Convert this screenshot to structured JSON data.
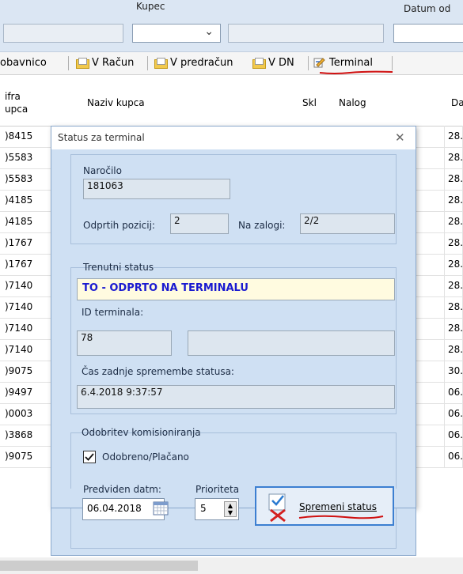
{
  "filter": {
    "kupec_label": "Kupec",
    "datum_od_label": "Datum od",
    "chevron": "⌄"
  },
  "toolbar": {
    "items": [
      {
        "label": "obavnico",
        "icon": ""
      },
      {
        "label": "V Račun",
        "icon": "folder-icon"
      },
      {
        "label": "V predračun",
        "icon": "folder-icon"
      },
      {
        "label": "V DN",
        "icon": "folder-icon"
      },
      {
        "label": "Terminal",
        "icon": "terminal-icon"
      }
    ]
  },
  "grid": {
    "headers": {
      "sifra_line1": "ifra",
      "sifra_line2": "upca",
      "naziv": "Naziv kupca",
      "skl": "Skl",
      "nalog": "Nalog",
      "da": "Da"
    },
    "rows": [
      {
        "sifra": ")8415",
        "datum": "28."
      },
      {
        "sifra": ")5583",
        "datum": "28."
      },
      {
        "sifra": ")5583",
        "datum": "28."
      },
      {
        "sifra": ")4185",
        "datum": "28."
      },
      {
        "sifra": ")4185",
        "datum": "28."
      },
      {
        "sifra": ")1767",
        "datum": "28."
      },
      {
        "sifra": ")1767",
        "datum": "28."
      },
      {
        "sifra": ")7140",
        "datum": "28."
      },
      {
        "sifra": ")7140",
        "datum": "28."
      },
      {
        "sifra": ")7140",
        "datum": "28."
      },
      {
        "sifra": ")7140",
        "datum": "28."
      },
      {
        "sifra": ")9075",
        "datum": "30."
      },
      {
        "sifra": ")9497",
        "datum": "06."
      },
      {
        "sifra": ")0003",
        "datum": "06."
      },
      {
        "sifra": ")3868",
        "datum": "06."
      },
      {
        "sifra": ")9075",
        "datum": "06."
      }
    ]
  },
  "dialog": {
    "title": "Status za terminal",
    "close": "✕",
    "narocilo_label": "Naročilo",
    "narocilo_value": "181063",
    "odprtih_label": "Odprtih pozicij:",
    "odprtih_value": "2",
    "zaloga_label": "Na zalogi:",
    "zaloga_value": "2/2",
    "trenutni_label": "Trenutni status",
    "status_value": "TO - ODPRTO NA TERMINALU",
    "terminal_label": "ID terminala:",
    "terminal_value": "78",
    "terminal_value2": "",
    "cas_label": "Čas zadnje spremembe statusa:",
    "cas_value": "6.4.2018 9:37:57",
    "odobritev_label": "Odobritev komisioniranja",
    "odobreno_label": "Odobreno/Plačano",
    "predviden_label": "Predviden datm:",
    "predviden_value": "06.04.2018",
    "prioriteta_label": "Prioriteta",
    "prioriteta_value": "5",
    "spremeni_label": "Spremeni status"
  },
  "colors": {
    "accent": "#1f5fbf",
    "status_bg": "#fffbe0",
    "status_text": "#1a1ad0",
    "underline": "#d01010"
  }
}
